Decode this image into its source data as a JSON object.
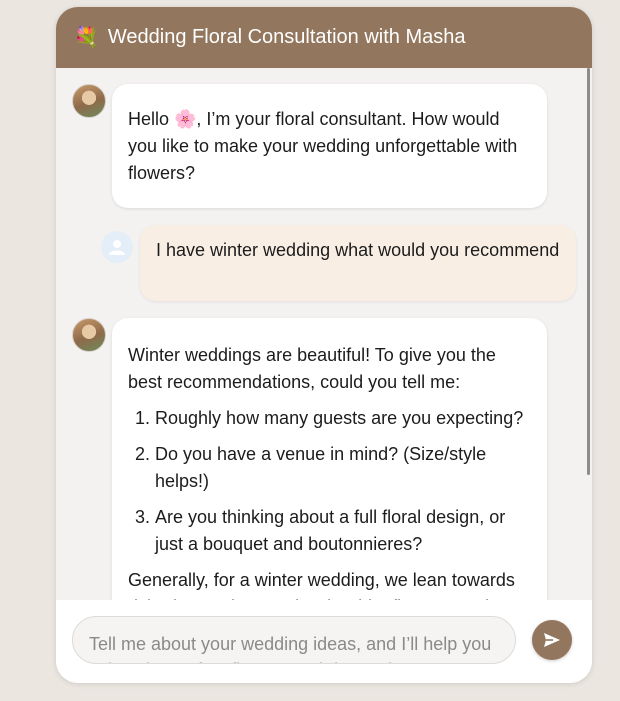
{
  "header": {
    "title": "Wedding Floral Consultation with Masha",
    "icon": "bouquet-icon",
    "emoji": "💐"
  },
  "colors": {
    "header_bg": "#93765e",
    "user_bubble_bg": "#f8eee4",
    "bot_bubble_bg": "#ffffff",
    "send_button_bg": "#93765e"
  },
  "messages": [
    {
      "role": "bot",
      "text": "Hello 🌸, I’m your floral consultant. How would you like to make your wedding unforgettable with flowers?"
    },
    {
      "role": "user",
      "text": "I have winter wedding what would you recommend"
    },
    {
      "role": "bot",
      "intro": "Winter weddings are beautiful! To give you the best recommendations, could you tell me:",
      "list": [
        "Roughly how many guests are you expecting?",
        "Do you have a venue in mind? (Size/style helps!)",
        "Are you thinking about a full floral design, or just a bouquet and boutonnieres?"
      ],
      "outro": "Generally, for a winter wedding, we lean towards rich, deep colors or classic white flowers, and evergreens."
    }
  ],
  "composer": {
    "placeholder": "Tell me about your wedding ideas, and I’ll help you select the perfect flowers and decorations!",
    "send_icon": "send-icon"
  }
}
